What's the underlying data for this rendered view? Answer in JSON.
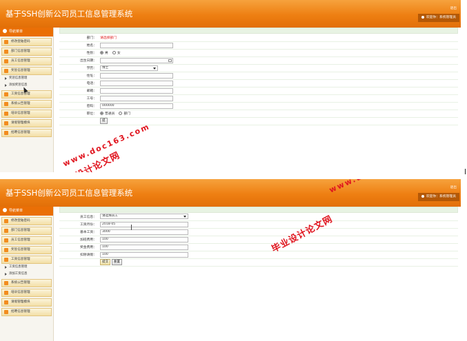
{
  "app": {
    "title": "基于SSH创新公司员工信息管理系统",
    "logout": "退出",
    "welcome": "欢迎你：系统管理员",
    "nav_header": "导航菜单"
  },
  "colors": {
    "accent": "#ee7f12",
    "sidebar_head": "#ea6f06",
    "menu_bg": "#f3dfa6",
    "required_red": "#e01f1f"
  },
  "panel1": {
    "menu": [
      "修改登陆密码",
      "部门信息管理",
      "员工信息管理",
      "奖惩信息管理",
      "工资信息管理",
      "系统公告管理",
      "培训信息管理",
      "请假管理模块",
      "招聘信息管理"
    ],
    "submenu": [
      "奖惩信息管理",
      "添加奖惩信息"
    ],
    "form": {
      "dept_label": "部门：",
      "dept_value": "请选择部门",
      "name_label": "姓名：",
      "gender_label": "性别：",
      "gender_male": "男",
      "gender_female": "女",
      "birth_label": "出生日期：",
      "edu_label": "学历：",
      "edu_value": "博士",
      "address_label": "住址：",
      "phone_label": "电话：",
      "email_label": "邮箱：",
      "empno_label": "工号：",
      "pwd_label": "密码：",
      "pwd_value": "000000",
      "position_label": "职位：",
      "pos_normal": "普通员",
      "pos_dept": "部门",
      "submit": "提"
    }
  },
  "panel2": {
    "menu": [
      "修改登陆密码",
      "部门信息管理",
      "员工信息管理",
      "奖惩信息管理",
      "工资信息管理",
      "系统公告管理",
      "培训信息管理",
      "请假管理模块",
      "招聘信息管理"
    ],
    "submenu": [
      "工资信息管理",
      "添加工资信息"
    ],
    "form": {
      "emp_label": "员工信息：",
      "emp_value": "请选择员工",
      "month_label": "工资月份：",
      "month_value": "2018-05",
      "base_label": "基本工资：",
      "base_value": "3000",
      "bonus_label": "加班费用：",
      "bonus_value": "100",
      "reward_label": "奖金费用：",
      "reward_value": "100",
      "leave_label": "扣除请假：",
      "leave_value": "100",
      "submit": "提交",
      "reset": "重置"
    }
  },
  "watermark": {
    "text": "毕业设计论文网",
    "url": "www.doc163.com"
  }
}
